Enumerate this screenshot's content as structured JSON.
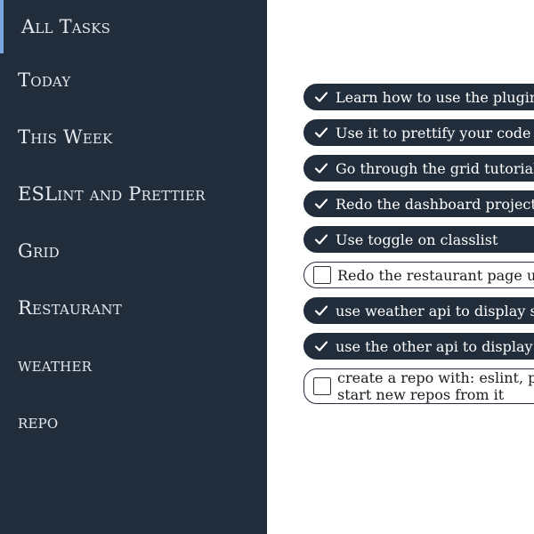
{
  "sidebar": {
    "items": [
      {
        "label": "All Tasks"
      },
      {
        "label": "Today"
      },
      {
        "label": "This Week"
      },
      {
        "label": "ESLint and Prettier"
      },
      {
        "label": "Grid"
      },
      {
        "label": "Restaurant"
      },
      {
        "label": "weather"
      },
      {
        "label": "repo"
      }
    ]
  },
  "tasks": [
    {
      "text": "Learn how to use the plugin",
      "checked": true
    },
    {
      "text": "Use it to prettify your code",
      "checked": true
    },
    {
      "text": "Go through the grid tutorial",
      "checked": true
    },
    {
      "text": "Redo the dashboard project",
      "checked": true
    },
    {
      "text": "Use toggle on classlist",
      "checked": true
    },
    {
      "text": "Redo the restaurant page u",
      "checked": false
    },
    {
      "text": "use weather api to display s",
      "checked": true
    },
    {
      "text": "use the other api to display",
      "checked": true
    },
    {
      "text_line1": "create a repo with: eslint, p",
      "text_line2": "start new repos from it",
      "checked": false
    }
  ],
  "colors": {
    "sidebar_bg": "#222d3c",
    "active_indicator": "#7aa6e0",
    "task_checked_bg": "#222d3c",
    "task_unchecked_bg": "#ffffff"
  },
  "icons": {
    "check": "checkmark-icon"
  }
}
